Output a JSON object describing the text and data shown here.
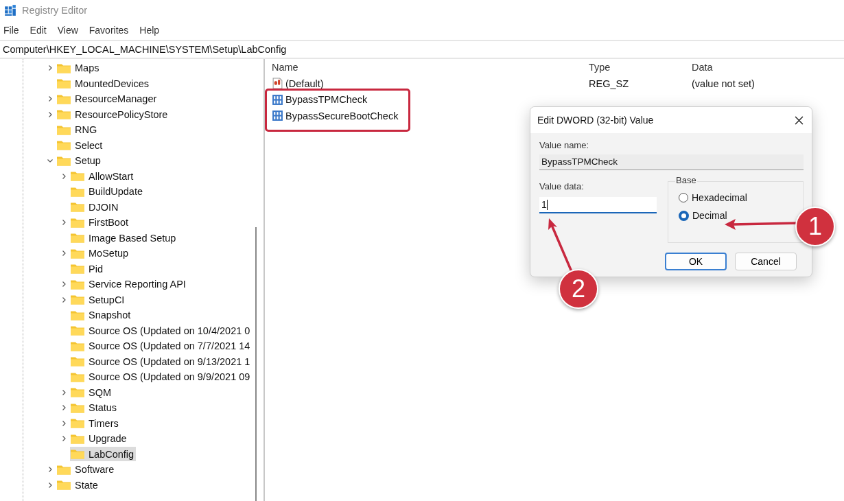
{
  "window": {
    "title": "Registry Editor"
  },
  "menu": [
    "File",
    "Edit",
    "View",
    "Favorites",
    "Help"
  ],
  "address": "Computer\\HKEY_LOCAL_MACHINE\\SYSTEM\\Setup\\LabConfig",
  "tree": [
    {
      "label": "Maps",
      "has_children": true,
      "expanded": false,
      "selected": false
    },
    {
      "label": "MountedDevices",
      "has_children": false,
      "selected": false
    },
    {
      "label": "ResourceManager",
      "has_children": true,
      "expanded": false,
      "selected": false
    },
    {
      "label": "ResourcePolicyStore",
      "has_children": true,
      "expanded": false,
      "selected": false
    },
    {
      "label": "RNG",
      "has_children": false,
      "selected": false
    },
    {
      "label": "Select",
      "has_children": false,
      "selected": false
    },
    {
      "label": "Setup",
      "has_children": true,
      "expanded": true,
      "selected": false,
      "children": [
        {
          "label": "AllowStart",
          "has_children": true,
          "expanded": false,
          "selected": false
        },
        {
          "label": "BuildUpdate",
          "has_children": false,
          "selected": false
        },
        {
          "label": "DJOIN",
          "has_children": false,
          "selected": false
        },
        {
          "label": "FirstBoot",
          "has_children": true,
          "expanded": false,
          "selected": false
        },
        {
          "label": "Image Based Setup",
          "has_children": false,
          "selected": false
        },
        {
          "label": "MoSetup",
          "has_children": true,
          "expanded": false,
          "selected": false
        },
        {
          "label": "Pid",
          "has_children": false,
          "selected": false
        },
        {
          "label": "Service Reporting API",
          "has_children": true,
          "expanded": false,
          "selected": false
        },
        {
          "label": "SetupCI",
          "has_children": true,
          "expanded": false,
          "selected": false
        },
        {
          "label": "Snapshot",
          "has_children": false,
          "selected": false
        },
        {
          "label": "Source OS (Updated on 10/4/2021 0",
          "has_children": false,
          "selected": false
        },
        {
          "label": "Source OS (Updated on 7/7/2021 14",
          "has_children": false,
          "selected": false
        },
        {
          "label": "Source OS (Updated on 9/13/2021 1",
          "has_children": false,
          "selected": false
        },
        {
          "label": "Source OS (Updated on 9/9/2021 09",
          "has_children": false,
          "selected": false
        },
        {
          "label": "SQM",
          "has_children": true,
          "expanded": false,
          "selected": false
        },
        {
          "label": "Status",
          "has_children": true,
          "expanded": false,
          "selected": false
        },
        {
          "label": "Timers",
          "has_children": true,
          "expanded": false,
          "selected": false
        },
        {
          "label": "Upgrade",
          "has_children": true,
          "expanded": false,
          "selected": false
        },
        {
          "label": "LabConfig",
          "has_children": false,
          "selected": true
        }
      ]
    },
    {
      "label": "Software",
      "has_children": true,
      "expanded": false,
      "selected": false
    },
    {
      "label": "State",
      "has_children": true,
      "expanded": false,
      "selected": false
    }
  ],
  "list": {
    "columns": [
      "Name",
      "Type",
      "Data"
    ],
    "rows": [
      {
        "kind": "string",
        "name": "(Default)",
        "type": "REG_SZ",
        "data": "(value not set)",
        "highlighted": false
      },
      {
        "kind": "dword",
        "name": "BypassTPMCheck",
        "highlighted": true
      },
      {
        "kind": "dword",
        "name": "BypassSecureBootCheck",
        "highlighted": true
      }
    ]
  },
  "dialog": {
    "title": "Edit DWORD (32-bit) Value",
    "value_name_label": "Value name:",
    "value_name": "BypassTPMCheck",
    "value_data_label": "Value data:",
    "value_data": "1",
    "base_label": "Base",
    "base_options": [
      {
        "label": "Hexadecimal",
        "selected": false
      },
      {
        "label": "Decimal",
        "selected": true
      }
    ],
    "buttons": [
      {
        "label": "OK",
        "default": true
      },
      {
        "label": "Cancel",
        "default": false
      }
    ]
  },
  "callouts": [
    {
      "number": "1"
    },
    {
      "number": "2"
    }
  ]
}
